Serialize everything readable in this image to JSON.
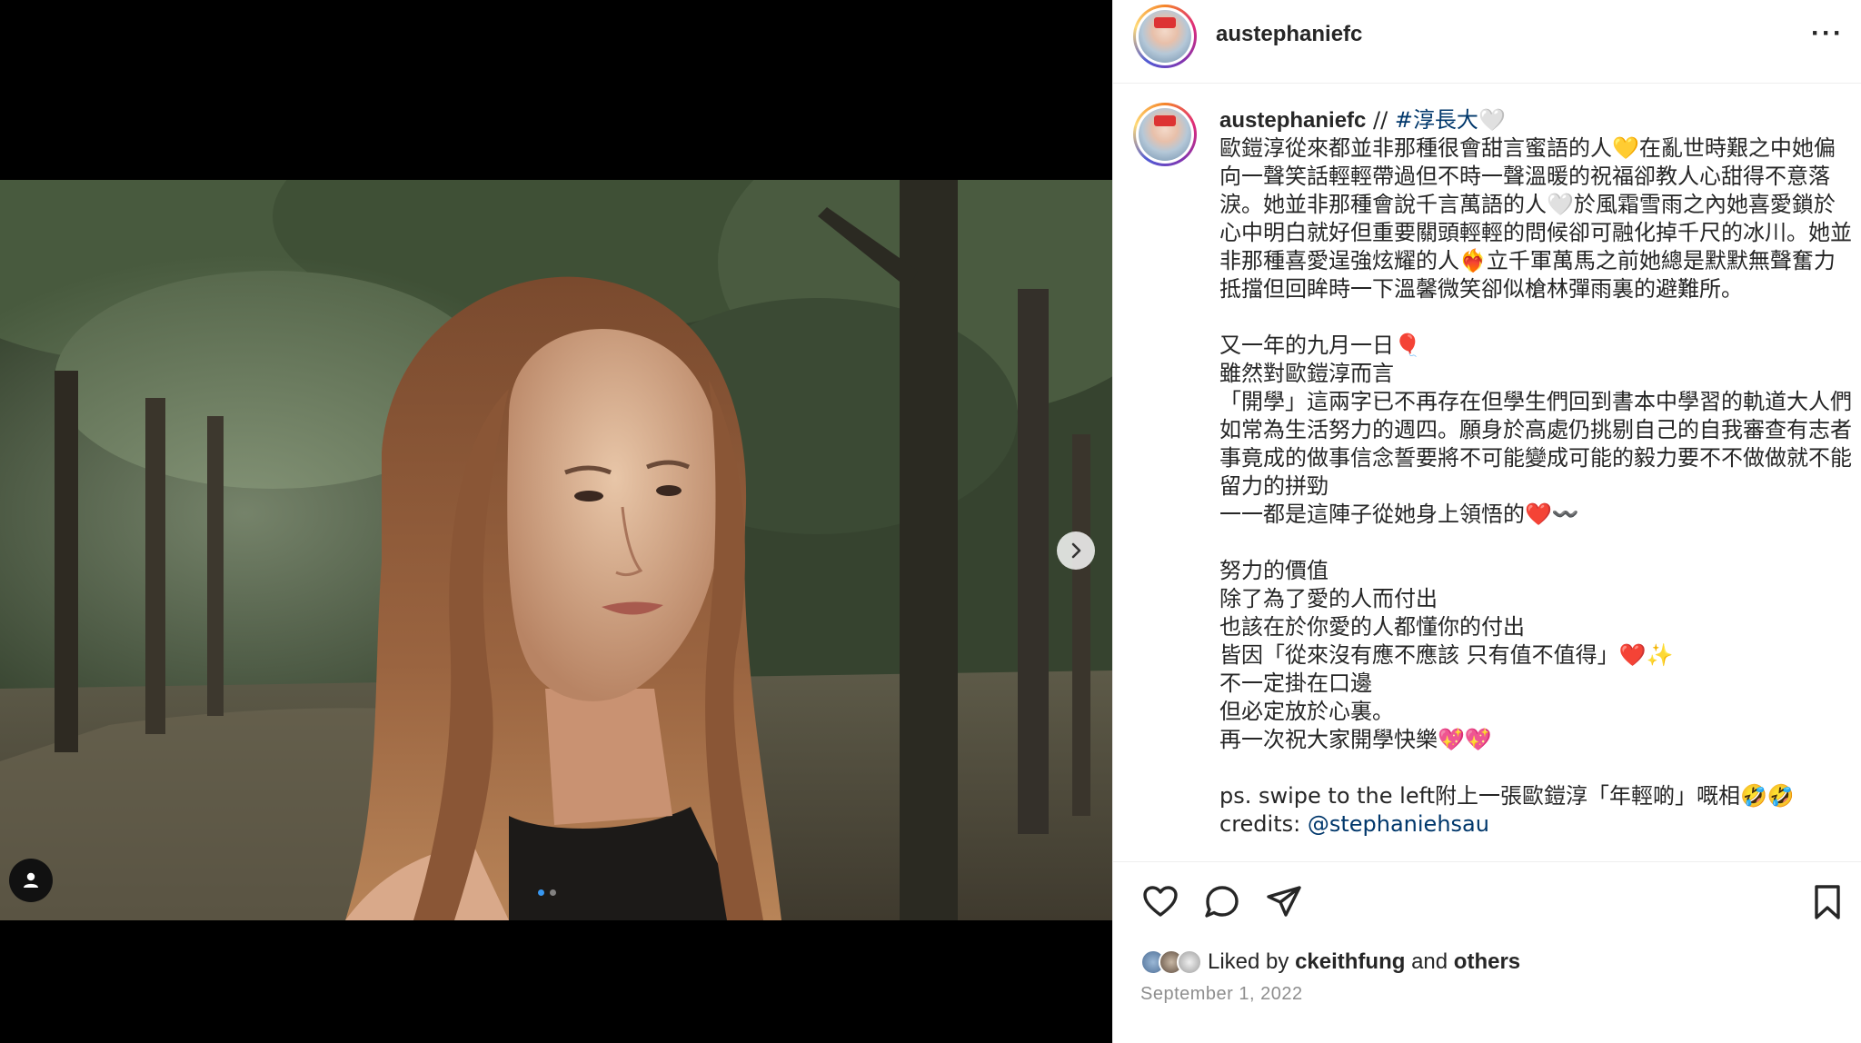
{
  "post": {
    "username": "austephaniefc",
    "caption_username": "austephaniefc",
    "caption_head_sep": " // ",
    "hashtag": "#淳長大",
    "hashtag_emoji": "🤍",
    "caption_lines": [
      "歐鎧淳從來都並非那種很會甜言蜜語的人💛在亂世時艱之中她偏向一聲笑話輕輕帶過但不時一聲溫暖的祝福卻教人心甜得不意落淚。她並非那種會說千言萬語的人🤍於風霜雪雨之內她喜愛鎖於心中明白就好但重要關頭輕輕的問候卻可融化掉千尺的冰川。她並非那種喜愛逞強炫耀的人❤️‍🔥立千軍萬馬之前她總是默默無聲奮力抵擋但回眸時一下溫馨微笑卻似槍林彈雨裏的避難所。",
      "",
      "又一年的九月一日🎈",
      "雖然對歐鎧淳而言",
      "「開學」這兩字已不再存在但學生們回到書本中學習的軌道大人們如常為生活努力的週四。願身於高處仍挑剔自己的自我審查有志者事竟成的做事信念誓要將不可能變成可能的毅力要不不做做就不能留力的拼勁",
      "一一都是這陣子從她身上領悟的❤️〰️",
      "",
      "努力的價值",
      "除了為了愛的人而付出",
      "也該在於你愛的人都懂你的付出",
      "皆因「從來沒有應不應該 只有值不值得」❤️✨",
      "不一定掛在口邊",
      "但必定放於心裏。",
      "再一次祝大家開學快樂💖💖",
      "",
      "ps. swipe to the left附上一張歐鎧淳「年輕啲」嘅相🤣🤣"
    ],
    "credits_label": "credits: ",
    "credits_link": "@stephaniehsau",
    "liked_by_prefix": "Liked by ",
    "liked_by_user": "ckeithfung",
    "liked_by_mid": " and ",
    "liked_by_others": "others",
    "date": "September 1, 2022",
    "carousel": {
      "count": 2,
      "active_index": 0
    }
  },
  "icons": {
    "more": "more-horizontal-icon",
    "next": "chevron-right-icon",
    "tag": "user-tag-icon",
    "like": "heart-icon",
    "comment": "comment-icon",
    "share": "share-paper-plane-icon",
    "save": "bookmark-icon"
  },
  "colors": {
    "text": "#262626",
    "secondary": "#8e8e8e",
    "link": "#00376b",
    "divider": "#efefef",
    "carousel_active": "#3897f0"
  }
}
